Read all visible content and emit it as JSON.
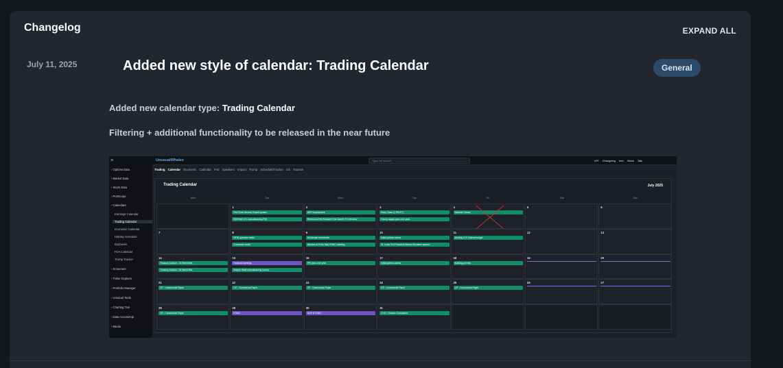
{
  "changelog": {
    "title": "Changelog",
    "expand_all_label": "EXPAND ALL"
  },
  "entry": {
    "date": "July 11, 2025",
    "title": "Added new style of calendar: Trading Calendar",
    "badge": "General",
    "line1_prefix": "Added new calendar type: ",
    "line1_bold": "Trading Calendar",
    "line2": "Filtering + additional functionality to be released in the near future"
  },
  "screenshot": {
    "logo_prefix": "Unusual",
    "logo_suffix": "Whales",
    "search_placeholder": "Type / to search",
    "top_links": "API Changelog Info Stock Talk",
    "tabs_active": "Trading Calendar",
    "tabs_rest": "Economic Calendar  Fed Speakers Impact  Trump Schedule/Tracker  US Tourism",
    "calendar_title": "Trading Calendar",
    "month_label": "July 2025",
    "sidebar": [
      {
        "label": "Options Data",
        "type": "nav"
      },
      {
        "label": "Market Data",
        "type": "nav"
      },
      {
        "label": "Stock Data",
        "type": "nav"
      },
      {
        "label": "Portscope",
        "type": "nav"
      },
      {
        "label": "Calendars",
        "type": "nav"
      },
      {
        "label": "Earnings Calendar",
        "type": "sub"
      },
      {
        "label": "Trading Calendar",
        "type": "active"
      },
      {
        "label": "Economic Calendar",
        "type": "sub"
      },
      {
        "label": "Holiday Schedule",
        "type": "sub"
      },
      {
        "label": "Buybacks",
        "type": "sub"
      },
      {
        "label": "FDA Calendar",
        "type": "sub"
      },
      {
        "label": "Trump Tracker",
        "type": "sub"
      },
      {
        "label": "Screeners",
        "type": "nav"
      },
      {
        "label": "Ticker Explorer",
        "type": "nav"
      },
      {
        "label": "Portfolio Manager",
        "type": "nav"
      },
      {
        "label": "Unusual Tools",
        "type": "nav"
      },
      {
        "label": "Charting Tool",
        "type": "nav"
      },
      {
        "label": "Data Access/Api",
        "type": "nav"
      },
      {
        "label": "Media",
        "type": "nav"
      }
    ],
    "weekdays": [
      "Mon",
      "Tue",
      "Wed",
      "Thu",
      "Fri",
      "Sat",
      "Sun"
    ],
    "weeks": [
      [
        {
          "day": "",
          "events": [],
          "past": true
        },
        {
          "day": "1",
          "events": [
            {
              "t": "Fed Chair Jerome Powell speaks",
              "c": "g"
            },
            {
              "t": "ISM final U.S. manufacturing PMI",
              "c": "g"
            }
          ]
        },
        {
          "day": "2",
          "events": [
            {
              "t": "ADP employment",
              "c": "g"
            },
            {
              "t": "Richmond Fed President Tom Barkin TV interview",
              "c": "g"
            }
          ]
        },
        {
          "day": "3",
          "events": [
            {
              "t": "Early Close (1 PM ET)",
              "c": "g"
            },
            {
              "t": "Hourly wages year over year",
              "c": "g"
            }
          ]
        },
        {
          "day": "4",
          "events": [
            {
              "t": "Markets Closed",
              "c": "g"
            }
          ],
          "cross": true
        },
        {
          "day": "5",
          "events": []
        },
        {
          "day": "6",
          "events": []
        }
      ],
      [
        {
          "day": "7",
          "events": []
        },
        {
          "day": "8",
          "events": [
            {
              "t": "NFIB optimism index",
              "c": "g"
            },
            {
              "t": "Consumer credit",
              "c": "g"
            }
          ]
        },
        {
          "day": "9",
          "events": [
            {
              "t": "Wholesale inventories",
              "c": "g"
            },
            {
              "t": "Minutes of Fed's May FOMC meeting",
              "c": "g"
            }
          ]
        },
        {
          "day": "10",
          "events": [
            {
              "t": "Initial jobless claims",
              "c": "g"
            },
            {
              "t": "St. Louis Fed President Alberto Musalem speech",
              "c": "g"
            }
          ]
        },
        {
          "day": "11",
          "events": [
            {
              "t": "Monthly U.S. federal budget",
              "c": "g"
            }
          ]
        },
        {
          "day": "12",
          "events": []
        },
        {
          "day": "13",
          "events": []
        }
      ],
      [
        {
          "day": "14",
          "events": [
            {
              "t": "Treasury Auction - 13 Week Bills",
              "c": "g"
            },
            {
              "t": "Treasury Auction - 26 Week Bills",
              "c": "g"
            }
          ]
        },
        {
          "day": "15",
          "events": [
            {
              "t": "Fastenal earnings",
              "c": "p"
            },
            {
              "t": "Empire State manufacturing survey",
              "c": "g"
            }
          ]
        },
        {
          "day": "16",
          "events": [
            {
              "t": "PPI year over year",
              "c": "g"
            }
          ]
        },
        {
          "day": "17",
          "events": [
            {
              "t": "Initial jobless claims",
              "c": "g"
            }
          ]
        },
        {
          "day": "18",
          "events": [
            {
              "t": "Building permits",
              "c": "g"
            }
          ]
        },
        {
          "day": "19",
          "events": [],
          "line": true
        },
        {
          "day": "20",
          "events": [],
          "line": true
        }
      ],
      [
        {
          "day": "21",
          "events": [
            {
              "t": "CP - Commercial Paper",
              "c": "g"
            }
          ]
        },
        {
          "day": "22",
          "events": [
            {
              "t": "CP - Commercial Paper",
              "c": "g"
            }
          ]
        },
        {
          "day": "23",
          "events": [
            {
              "t": "CP - Commercial Paper",
              "c": "g"
            }
          ]
        },
        {
          "day": "24",
          "events": [
            {
              "t": "CP - Commercial Paper",
              "c": "g"
            }
          ]
        },
        {
          "day": "25",
          "events": [
            {
              "t": "CP - Commercial Paper",
              "c": "g"
            }
          ]
        },
        {
          "day": "26",
          "events": [],
          "line": true
        },
        {
          "day": "27",
          "events": [],
          "line": true
        }
      ],
      [
        {
          "day": "28",
          "events": [
            {
              "t": "CP - Commercial Paper",
              "c": "g"
            }
          ]
        },
        {
          "day": "29",
          "events": [
            {
              "t": "FOMC",
              "c": "p"
            }
          ]
        },
        {
          "day": "30",
          "events": [
            {
              "t": "GDP & FOMC",
              "c": "p"
            }
          ]
        },
        {
          "day": "31",
          "events": [
            {
              "t": "G.19 - Finance Companies",
              "c": "g"
            }
          ]
        },
        {
          "day": "",
          "events": [],
          "past": true
        },
        {
          "day": "",
          "events": [],
          "past": true
        },
        {
          "day": "",
          "events": [],
          "past": true
        }
      ]
    ]
  },
  "colors": {
    "page_bg": "#14171c",
    "card_bg": "#22262e",
    "badge_bg": "#2c4a68",
    "event_green": "#0e8f67",
    "event_purple": "#6d55c4"
  }
}
